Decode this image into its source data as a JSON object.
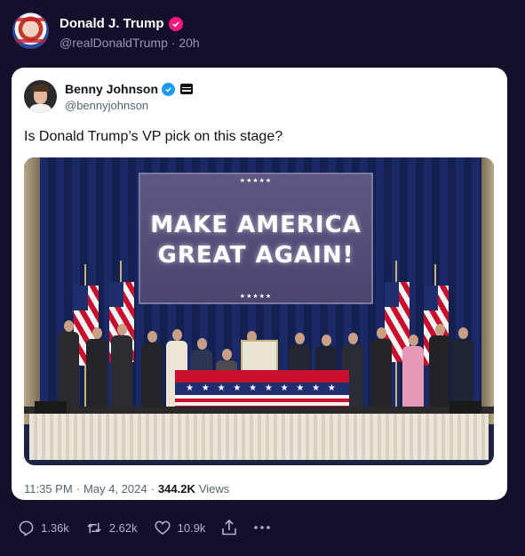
{
  "post": {
    "author_name": "Donald J. Trump",
    "author_handle": "@realDonaldTrump",
    "separator": "·",
    "time_ago": "20h"
  },
  "quote": {
    "author_name": "Benny Johnson",
    "author_handle": "@bennyjohnson",
    "text": "Is Donald Trump’s VP pick on this stage?",
    "image": {
      "screen_line1": "MAKE AMERICA",
      "screen_line2": "GREAT AGAIN!",
      "stars": "★★★★★",
      "banner_stars": "★ ★ ★ ★ ★ ★ ★ ★ ★ ★"
    },
    "footer": {
      "time": "11:35 PM",
      "separator": "·",
      "date": "May 4, 2024",
      "views_count": "344.2K",
      "views_label": "Views"
    }
  },
  "actions": {
    "replies": "1.36k",
    "reposts": "2.62k",
    "likes": "10.9k"
  },
  "colors": {
    "background": "#150f2c",
    "verified_pink": "#f91880",
    "verified_blue": "#1d9bf0",
    "muted_text": "#9b93b2"
  }
}
